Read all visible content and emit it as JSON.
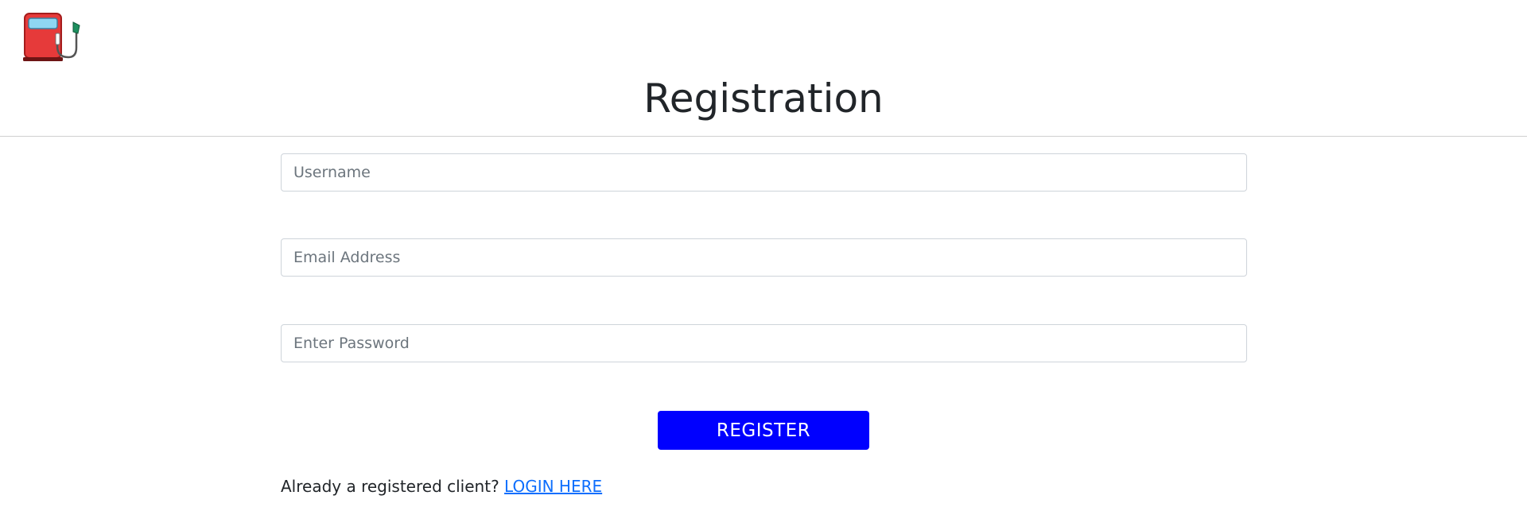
{
  "header": {
    "logo_icon": "fuel-pump-icon",
    "title": "Registration"
  },
  "form": {
    "username": {
      "placeholder": "Username",
      "value": ""
    },
    "email": {
      "placeholder": "Email Address",
      "value": ""
    },
    "password": {
      "placeholder": "Enter Password",
      "value": ""
    },
    "submit_label": "REGISTER",
    "submit_color": "#0000ff"
  },
  "footer": {
    "prompt": "Already a registered client?",
    "link_label": "LOGIN HERE",
    "link_color": "#0d6efd"
  }
}
